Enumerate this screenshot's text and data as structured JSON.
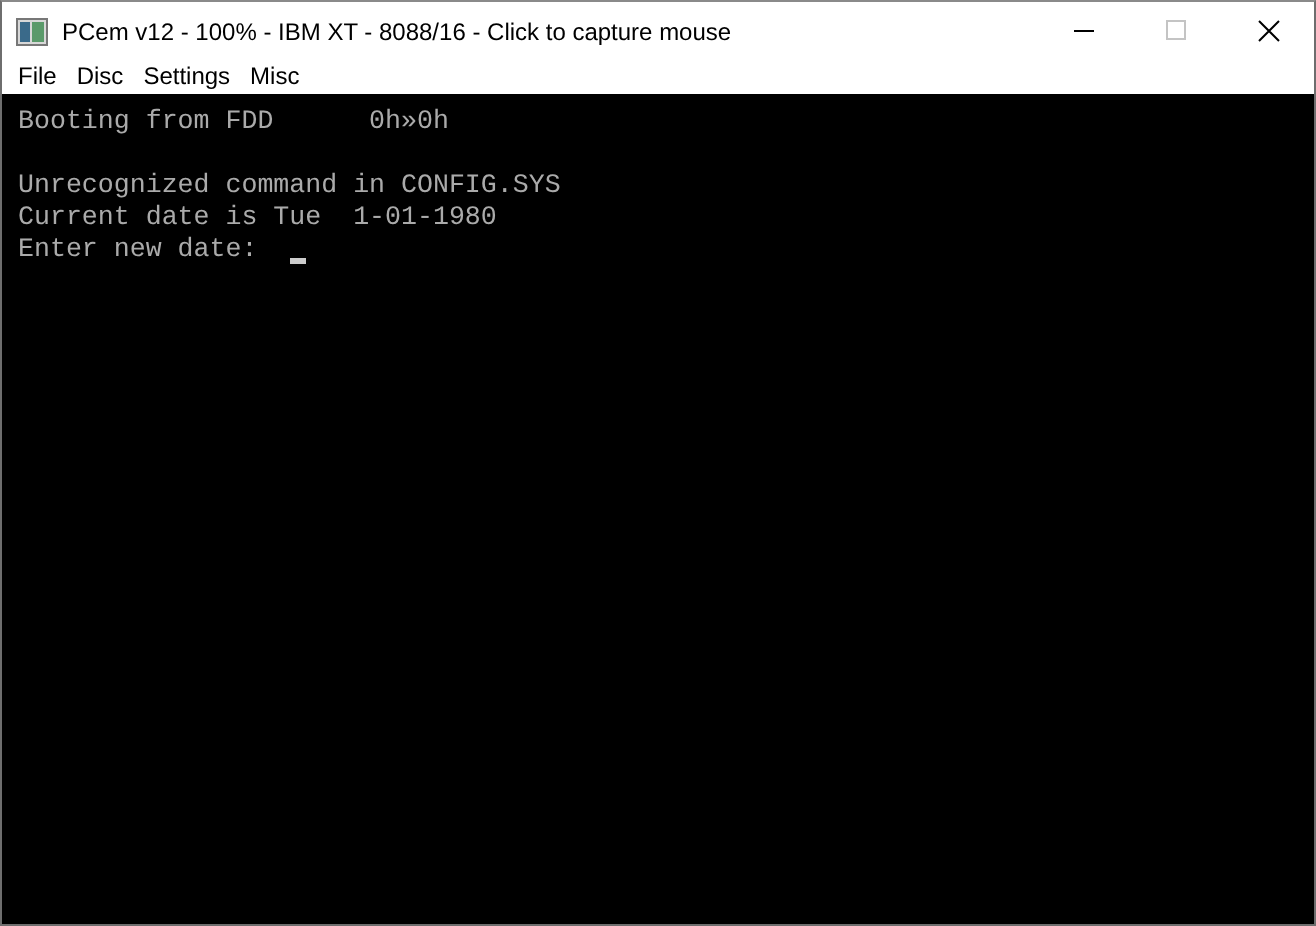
{
  "window": {
    "title": "PCem v12 - 100% - IBM XT - 8088/16 - Click to capture mouse"
  },
  "menu": [
    "File",
    "Disc",
    "Settings",
    "Misc"
  ],
  "screen": {
    "blocks": [
      [
        "Booting from FDD      0h»0h"
      ],
      [
        "Unrecognized command in CONFIG.SYS",
        "Current date is Tue  1-01-1980"
      ]
    ],
    "prompt": "Enter new date:"
  }
}
